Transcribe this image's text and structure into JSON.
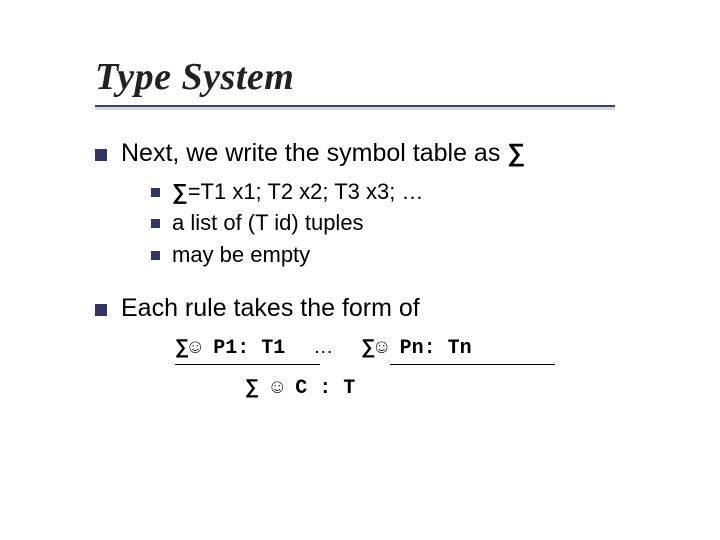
{
  "title": "Type System",
  "sigma_glyph": "∑",
  "turnstile_glyph": "☺",
  "l1_items": [
    "Next, we write the symbol table as ",
    "Each rule takes the form of"
  ],
  "l2_items": [
    "=T1 x1; T2 x2; T3 x3; …",
    "a list of (T id) tuples",
    "may be empty"
  ],
  "rule": {
    "p1": " P1: T1",
    "dots": "…",
    "pn": " Pn: Tn",
    "c": " C : T"
  }
}
